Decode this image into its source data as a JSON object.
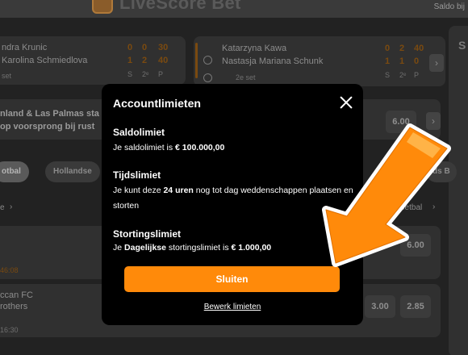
{
  "header": {
    "brand": "LiveScore Bet",
    "saldo_link": "Saldo bij"
  },
  "matches": [
    {
      "p1": "ndra Krunic",
      "p2": "Karolina Schmiedlova",
      "p1_scores": [
        "0",
        "0",
        "30"
      ],
      "p2_scores": [
        "1",
        "2",
        "40"
      ],
      "meta_set": "2ᵉ",
      "meta_s": "S",
      "meta_p": "P",
      "status": "set"
    },
    {
      "p1": "Katarzyna Kawa",
      "p2": "Nastasja Mariana Schunk",
      "p1_scores": [
        "0",
        "2",
        "40"
      ],
      "p2_scores": [
        "1",
        "1",
        "0"
      ],
      "meta_set": "2ᵉ",
      "meta_s": "S",
      "meta_p": "P",
      "status": "2e set"
    }
  ],
  "promo": {
    "line1": "nland & Las Palmas sta",
    "line2": "op voorsprong bij rust",
    "odd": "6.00"
  },
  "chips": {
    "football": "otbal",
    "hollandse": "Hollandse",
    "right": "ds B"
  },
  "sections": {
    "left_label": "e",
    "right_label": "oetbal",
    "time1": "46:08",
    "team1": "ccan FC",
    "team2": "rothers",
    "time2": "16:30"
  },
  "odds": {
    "row1_b": "6.00",
    "row2_a": "3.00",
    "row2_b": "2.85"
  },
  "side_panel": {
    "label": "S"
  },
  "modal": {
    "title": "Accountlimieten",
    "saldo": {
      "heading": "Saldolimiet",
      "pre": "Je saldolimiet is ",
      "value": "€ 100.000,00"
    },
    "tijd": {
      "heading": "Tijdslimiet",
      "pre": "Je kunt deze ",
      "value": "24 uren",
      "post": " nog tot dag weddenschappen plaatsen en storten"
    },
    "storting": {
      "heading": "Stortingslimiet",
      "pre": "Je ",
      "value1": "Dagelijkse",
      "mid": " stortingslimiet is ",
      "value2": "€ 1.000,00"
    },
    "button": "Sluiten",
    "link": "Bewerk limieten"
  },
  "colors": {
    "accent": "#ff8a0a",
    "modal_bg": "#000000",
    "page_bg": "#222222"
  }
}
